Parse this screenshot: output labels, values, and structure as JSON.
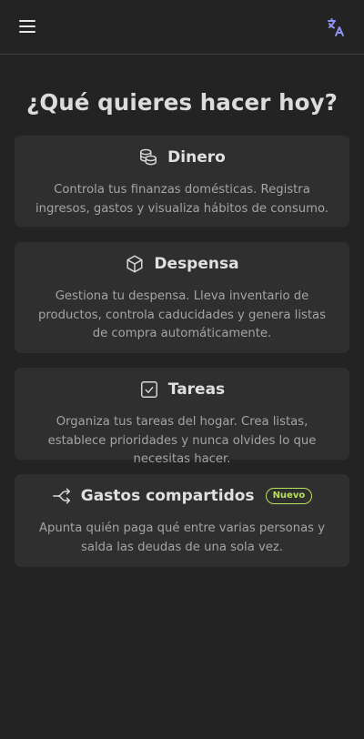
{
  "header": {
    "menu_icon": "hamburger-menu-icon",
    "language_icon": "translate-icon"
  },
  "main": {
    "title": "¿Qué quieres hacer hoy?"
  },
  "cards": [
    {
      "icon": "coins-icon",
      "title": "Dinero",
      "description": "Controla tus finanzas domésticas. Registra ingresos, gastos y visualiza hábitos de consumo."
    },
    {
      "icon": "box-icon",
      "title": "Despensa",
      "description": "Gestiona tu despensa. Lleva inventario de productos, controla caducidades y genera listas de compra automáticamente."
    },
    {
      "icon": "checkbox-icon",
      "title": "Tareas",
      "description": "Organiza tus tareas del hogar. Crea listas, establece prioridades y nunca olvides lo que necesitas hacer."
    },
    {
      "icon": "split-arrows-icon",
      "title": "Gastos compartidos",
      "badge": "Nuevo",
      "description": "Apunta quién paga qué entre varias personas y salda las deudas de una sola vez."
    }
  ],
  "colors": {
    "background": "#232323",
    "card": "#2f2f2f",
    "accent_badge": "#b8e05a",
    "translate_icon": "#8f93f0"
  }
}
